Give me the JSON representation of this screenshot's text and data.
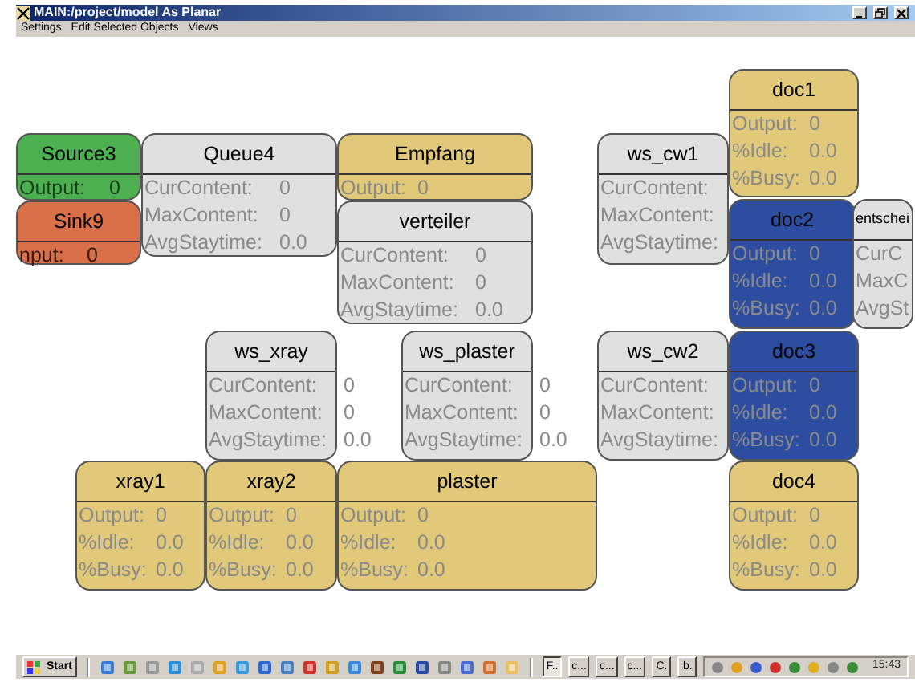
{
  "window": {
    "title": "MAIN:/project/model As Planar"
  },
  "menu": [
    "Settings",
    "Edit Selected Objects",
    "Views"
  ],
  "nodes": [
    {
      "name": "Source3",
      "kind": "source",
      "color": "#4caf50",
      "rows": [
        {
          "label": "Output:",
          "value": "0"
        }
      ]
    },
    {
      "name": "Sink9",
      "kind": "sink",
      "color": "#d9704a",
      "rows": [
        {
          "label": "nput:",
          "value": "0"
        }
      ]
    },
    {
      "name": "Queue4",
      "kind": "queue",
      "color": "#e0e0e0",
      "rows": [
        {
          "label": "CurContent:",
          "value": "0"
        },
        {
          "label": "MaxContent:",
          "value": "0"
        },
        {
          "label": "AvgStaytime:",
          "value": "0.0"
        }
      ]
    },
    {
      "name": "Empfang",
      "kind": "server",
      "color": "#e2c97a",
      "rows": [
        {
          "label": "Output:",
          "value": "0"
        }
      ]
    },
    {
      "name": "verteiler",
      "kind": "queue",
      "color": "#e0e0e0",
      "rows": [
        {
          "label": "CurContent:",
          "value": "0"
        },
        {
          "label": "MaxContent:",
          "value": "0"
        },
        {
          "label": "AvgStaytime:",
          "value": "0.0"
        }
      ]
    },
    {
      "name": "ws_cw1",
      "kind": "queue",
      "color": "#e0e0e0",
      "rows": [
        {
          "label": "CurContent:"
        },
        {
          "label": "MaxContent:"
        },
        {
          "label": "AvgStaytime:"
        }
      ]
    },
    {
      "name": "doc1",
      "kind": "server",
      "color": "#e2c97a",
      "rows": [
        {
          "label": "Output:",
          "value": "0"
        },
        {
          "label": "%Idle:",
          "value": "0.0"
        },
        {
          "label": "%Busy:",
          "value": "0.0"
        }
      ]
    },
    {
      "name": "doc2",
      "kind": "server",
      "color": "#2d4ea0",
      "rows": [
        {
          "label": "Output:",
          "value": "0"
        },
        {
          "label": "%Idle:",
          "value": "0.0"
        },
        {
          "label": "%Busy:",
          "value": "0.0"
        }
      ]
    },
    {
      "name": "entschei",
      "kind": "queue",
      "color": "#e0e0e0",
      "rows": [
        {
          "label": "CurC"
        },
        {
          "label": "MaxC"
        },
        {
          "label": "AvgSt"
        }
      ]
    },
    {
      "name": "ws_xray",
      "kind": "queue",
      "color": "#e0e0e0",
      "rows": [
        {
          "label": "CurContent:",
          "value": "0"
        },
        {
          "label": "MaxContent:",
          "value": "0"
        },
        {
          "label": "AvgStaytime:",
          "value": "0.0"
        }
      ]
    },
    {
      "name": "ws_plaster",
      "kind": "queue",
      "color": "#e0e0e0",
      "rows": [
        {
          "label": "CurContent:",
          "value": "0"
        },
        {
          "label": "MaxContent:",
          "value": "0"
        },
        {
          "label": "AvgStaytime:",
          "value": "0.0"
        }
      ]
    },
    {
      "name": "ws_cw2",
      "kind": "queue",
      "color": "#e0e0e0",
      "rows": [
        {
          "label": "CurContent:"
        },
        {
          "label": "MaxContent:"
        },
        {
          "label": "AvgStaytime:"
        }
      ]
    },
    {
      "name": "doc3",
      "kind": "server",
      "color": "#2d4ea0",
      "rows": [
        {
          "label": "Output:",
          "value": "0"
        },
        {
          "label": "%Idle:",
          "value": "0.0"
        },
        {
          "label": "%Busy:",
          "value": "0.0"
        }
      ]
    },
    {
      "name": "xray1",
      "kind": "server",
      "color": "#e2c97a",
      "rows": [
        {
          "label": "Output:",
          "value": "0"
        },
        {
          "label": "%Idle:",
          "value": "0.0"
        },
        {
          "label": "%Busy:",
          "value": "0.0"
        }
      ]
    },
    {
      "name": "xray2",
      "kind": "server",
      "color": "#e2c97a",
      "rows": [
        {
          "label": "Output:",
          "value": "0"
        },
        {
          "label": "%Idle:",
          "value": "0.0"
        },
        {
          "label": "%Busy:",
          "value": "0.0"
        }
      ]
    },
    {
      "name": "plaster",
      "kind": "server",
      "color": "#e2c97a",
      "rows": [
        {
          "label": "Output:",
          "value": "0"
        },
        {
          "label": "%Idle:",
          "value": "0.0"
        },
        {
          "label": "%Busy:",
          "value": "0.0"
        }
      ]
    },
    {
      "name": "doc4",
      "kind": "server",
      "color": "#e2c97a",
      "rows": [
        {
          "label": "Output:",
          "value": "0"
        },
        {
          "label": "%Idle:",
          "value": "0.0"
        },
        {
          "label": "%Busy:",
          "value": "0.0"
        }
      ]
    }
  ],
  "taskbar": {
    "start": "Start",
    "tasks": [
      {
        "label": "F..",
        "selected": true
      },
      {
        "label": "c...",
        "selected": false
      },
      {
        "label": "c...",
        "selected": false
      },
      {
        "label": "c...",
        "selected": false
      },
      {
        "label": "C.",
        "selected": false
      },
      {
        "label": "b.",
        "selected": false
      }
    ],
    "clock": "15:43"
  }
}
